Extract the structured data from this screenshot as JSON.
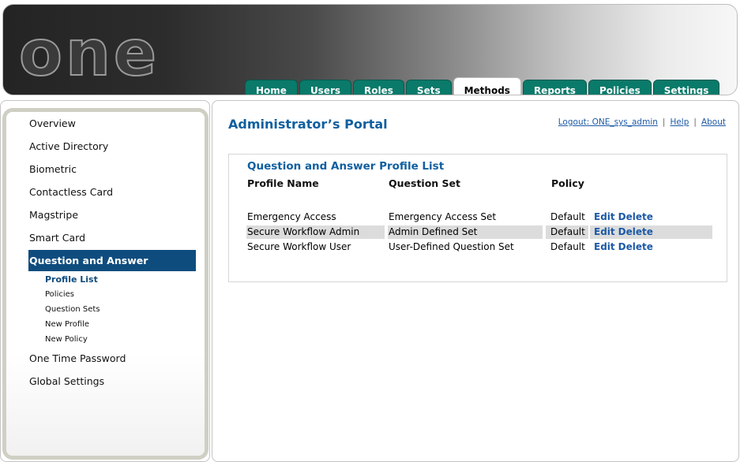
{
  "header": {
    "logo_text": "one",
    "tabs": [
      {
        "label": "Home"
      },
      {
        "label": "Users"
      },
      {
        "label": "Roles"
      },
      {
        "label": "Sets"
      },
      {
        "label": "Methods"
      },
      {
        "label": "Reports"
      },
      {
        "label": "Policies"
      },
      {
        "label": "Settings"
      }
    ],
    "active_tab": "Methods"
  },
  "sidebar": {
    "items": [
      {
        "label": "Overview"
      },
      {
        "label": "Active Directory"
      },
      {
        "label": "Biometric"
      },
      {
        "label": "Contactless Card"
      },
      {
        "label": "Magstripe"
      },
      {
        "label": "Smart Card"
      },
      {
        "label": "Question and Answer"
      },
      {
        "label": "One Time Password"
      },
      {
        "label": "Global Settings"
      }
    ],
    "sub_items": [
      {
        "label": "Profile List"
      },
      {
        "label": "Policies"
      },
      {
        "label": "Question Sets"
      },
      {
        "label": "New Profile"
      },
      {
        "label": "New Policy"
      }
    ]
  },
  "main": {
    "title": "Administrator’s Portal",
    "links": {
      "logout": "Logout: ONE_sys_admin",
      "help": "Help",
      "about": "About",
      "separator": "|"
    },
    "panel": {
      "title": "Question and Answer Profile List",
      "columns": [
        "Profile Name",
        "Question Set",
        "Policy"
      ],
      "rows": [
        {
          "name": "Emergency Access",
          "question_set": "Emergency Access Set",
          "policy": "Default",
          "edit": "Edit",
          "delete": "Delete"
        },
        {
          "name": "Secure Workflow Admin",
          "question_set": "Admin Defined Set",
          "policy": "Default",
          "edit": "Edit",
          "delete": "Delete"
        },
        {
          "name": "Secure Workflow User",
          "question_set": "User-Defined Question Set",
          "policy": "Default",
          "edit": "Edit",
          "delete": "Delete"
        }
      ]
    }
  },
  "colors": {
    "tab_bg": "#0a7a6a",
    "accent_blue": "#0f5fa0",
    "nav_active_bg": "#0f4c7e",
    "link_blue": "#1d5aa6",
    "row_shade": "#dcdcdc"
  }
}
